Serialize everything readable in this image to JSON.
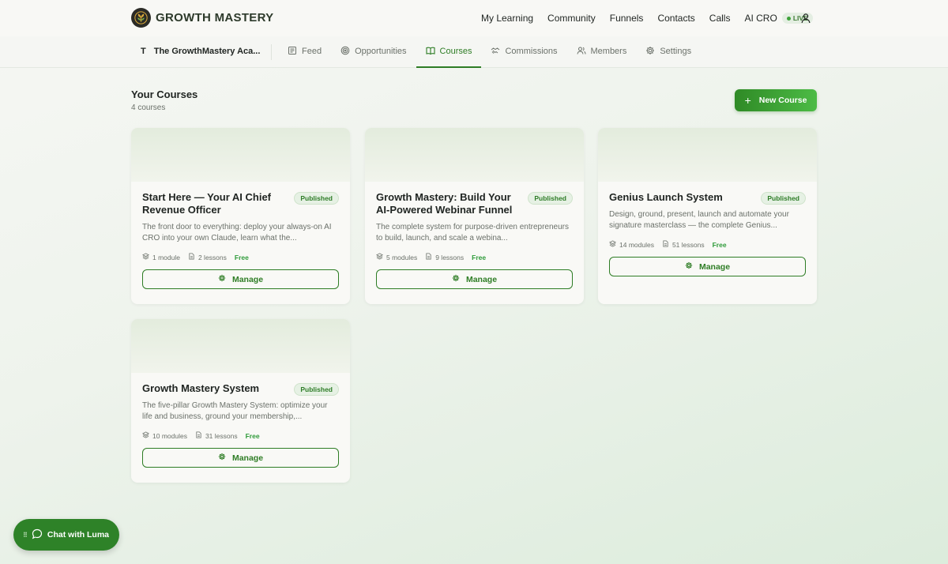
{
  "header": {
    "brand": "GROWTH MASTERY",
    "nav": [
      "My Learning",
      "Community",
      "Funnels",
      "Contacts",
      "Calls",
      "AI CRO"
    ],
    "live_badge": "LIVE"
  },
  "subnav": {
    "academy_initial": "T",
    "academy_name": "The GrowthMastery Aca...",
    "tabs": [
      {
        "label": "Feed",
        "icon": "newspaper-icon"
      },
      {
        "label": "Opportunities",
        "icon": "target-icon"
      },
      {
        "label": "Courses",
        "icon": "book-icon",
        "active": true
      },
      {
        "label": "Commissions",
        "icon": "handshake-icon"
      },
      {
        "label": "Members",
        "icon": "users-icon"
      },
      {
        "label": "Settings",
        "icon": "gear-icon"
      }
    ]
  },
  "main": {
    "title": "Your Courses",
    "count": "4 courses",
    "new_course_label": "New Course"
  },
  "courses": [
    {
      "title": "Start Here — Your AI Chief Revenue Officer",
      "badge": "Published",
      "description": "The front door to everything: deploy your always-on AI CRO into your own Claude, learn what the...",
      "modules": "1 module",
      "lessons": "2 lessons",
      "price": "Free",
      "manage_label": "Manage"
    },
    {
      "title": "Growth Mastery: Build Your AI-Powered Webinar Funnel",
      "badge": "Published",
      "description": "The complete system for purpose-driven entrepreneurs to build, launch, and scale a webina...",
      "modules": "5 modules",
      "lessons": "9 lessons",
      "price": "Free",
      "manage_label": "Manage"
    },
    {
      "title": "Genius Launch System",
      "badge": "Published",
      "description": "Design, ground, present, launch and automate your signature masterclass — the complete Genius...",
      "modules": "14 modules",
      "lessons": "51 lessons",
      "price": "Free",
      "manage_label": "Manage"
    },
    {
      "title": "Growth Mastery System",
      "badge": "Published",
      "description": "The five-pillar Growth Mastery System: optimize your life and business, ground your membership,...",
      "modules": "10 modules",
      "lessons": "31 lessons",
      "price": "Free",
      "manage_label": "Manage"
    }
  ],
  "chat": {
    "label": "Chat with Luma"
  },
  "colors": {
    "accent": "#2e7d25",
    "accent_light": "#4cbb45",
    "free_text": "#2f9b3a"
  }
}
